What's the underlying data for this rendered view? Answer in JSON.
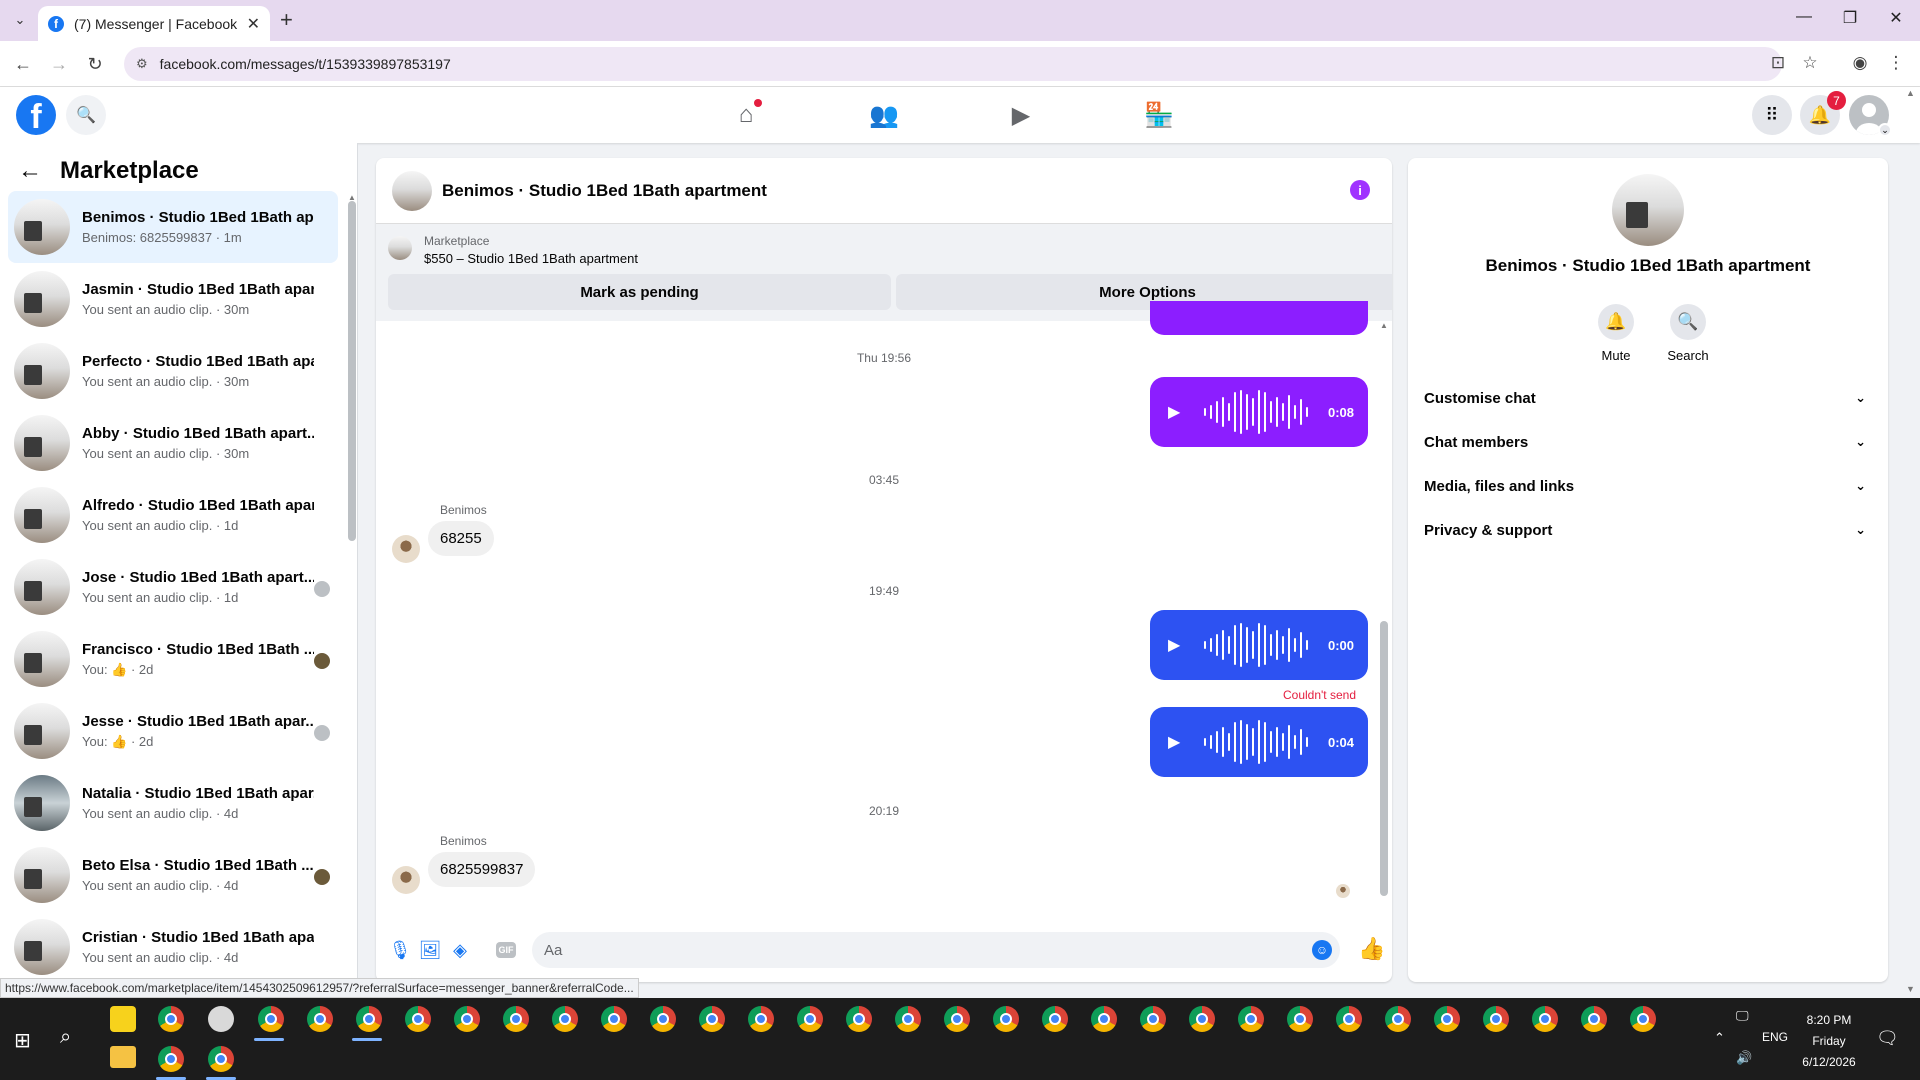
{
  "browser": {
    "tab_title": "(7) Messenger | Facebook",
    "url": "facebook.com/messages/t/1539339897853197",
    "hover_url": "https://www.facebook.com/marketplace/item/1454302509612957/?referralSurface=messenger_banner&referralCode..."
  },
  "fbnav": {
    "notification_count": "7"
  },
  "sidebar": {
    "title": "Marketplace",
    "conversations": [
      {
        "name": "Benimos · Studio 1Bed 1Bath apa...",
        "sub": "Benimos: 6825599837 · 1m"
      },
      {
        "name": "Jasmin · Studio 1Bed 1Bath apart...",
        "sub": "You sent an audio clip. · 30m"
      },
      {
        "name": "Perfecto · Studio 1Bed 1Bath apa...",
        "sub": "You sent an audio clip. · 30m"
      },
      {
        "name": "Abby · Studio 1Bed 1Bath apart...",
        "sub": "You sent an audio clip. · 30m"
      },
      {
        "name": "Alfredo · Studio 1Bed 1Bath apar...",
        "sub": "You sent an audio clip. · 1d"
      },
      {
        "name": "Jose · Studio 1Bed 1Bath apart...",
        "sub": "You sent an audio clip. · 1d"
      },
      {
        "name": "Francisco · Studio 1Bed 1Bath ...",
        "sub": "You: 👍 · 2d"
      },
      {
        "name": "Jesse · Studio 1Bed 1Bath apar...",
        "sub": "You: 👍 · 2d"
      },
      {
        "name": "Natalia · Studio 1Bed 1Bath apar...",
        "sub": "You sent an audio clip. · 4d"
      },
      {
        "name": "Beto Elsa · Studio 1Bed 1Bath ...",
        "sub": "You sent an audio clip. · 4d"
      },
      {
        "name": "Cristian · Studio 1Bed 1Bath apar...",
        "sub": "You sent an audio clip. · 4d"
      }
    ]
  },
  "chat": {
    "title": "Benimos · Studio 1Bed 1Bath apartment",
    "banner_label": "Marketplace",
    "banner_price": "$550 – Studio 1Bed 1Bath apartment",
    "btn_pending": "Mark as pending",
    "btn_more": "More Options",
    "time1": "Thu 19:56",
    "audio1_duration": "0:08",
    "time2": "03:45",
    "sender1": "Benimos",
    "msg1": "68255",
    "time3": "19:49",
    "audio2_duration": "0:00",
    "fail_text": "Couldn't send",
    "audio3_duration": "0:04",
    "time4": "20:19",
    "sender2": "Benimos",
    "msg2": "6825599837",
    "composer_placeholder": "Aa"
  },
  "rpanel": {
    "name": "Benimos · Studio 1Bed 1Bath apartment",
    "mute_label": "Mute",
    "search_label": "Search",
    "rows": [
      "Customise chat",
      "Chat members",
      "Media, files and links",
      "Privacy & support"
    ]
  },
  "taskbar": {
    "lang": "ENG",
    "time": "8:20 PM",
    "day": "Friday",
    "date": "6/12/2026"
  },
  "colors": {
    "fb_blue": "#1877f2",
    "sent_audio_purple": "#8c1eff",
    "sent_audio_blue": "#2d52f2",
    "error_red": "#e41e3f"
  }
}
